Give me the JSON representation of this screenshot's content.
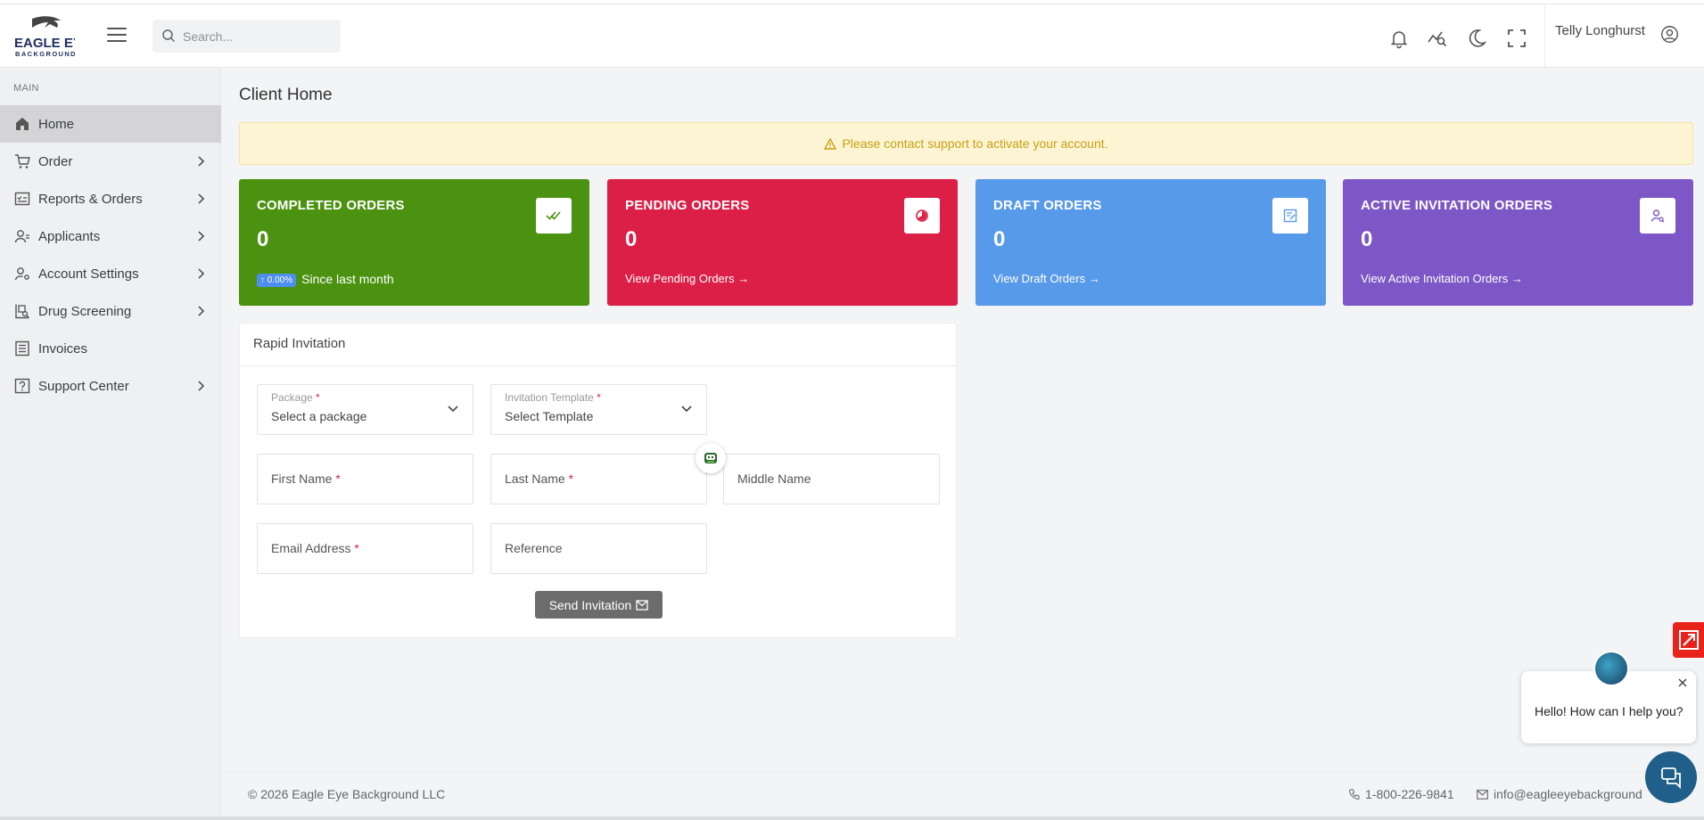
{
  "brand": {
    "logo_line1": "EAGLE EYE",
    "logo_line2": "BACKGROUNDS"
  },
  "search": {
    "placeholder": "Search..."
  },
  "header": {
    "user_name": "Telly Longhurst"
  },
  "sidebar": {
    "section_title": "MAIN",
    "items": [
      {
        "label": "Home",
        "icon": "home-icon",
        "active": true,
        "chevron": false
      },
      {
        "label": "Order",
        "icon": "cart-icon",
        "active": false,
        "chevron": true
      },
      {
        "label": "Reports & Orders",
        "icon": "report-icon",
        "active": false,
        "chevron": true
      },
      {
        "label": "Applicants",
        "icon": "applicants-icon",
        "active": false,
        "chevron": true
      },
      {
        "label": "Account Settings",
        "icon": "user-settings-icon",
        "active": false,
        "chevron": true
      },
      {
        "label": "Drug Screening",
        "icon": "drug-screening-icon",
        "active": false,
        "chevron": true
      },
      {
        "label": "Invoices",
        "icon": "invoice-icon",
        "active": false,
        "chevron": false
      },
      {
        "label": "Support Center",
        "icon": "support-icon",
        "active": false,
        "chevron": true
      }
    ]
  },
  "page": {
    "title": "Client Home",
    "alert": "Please contact support to activate your account."
  },
  "cards": [
    {
      "title": "COMPLETED ORDERS",
      "value": "0",
      "badge": "↑ 0.00%",
      "link": "Since last month",
      "color": "#4b9211",
      "icon": "double-check-icon"
    },
    {
      "title": "PENDING ORDERS",
      "value": "0",
      "link": "View Pending Orders",
      "color": "#dc1f47",
      "icon": "pending-icon"
    },
    {
      "title": "DRAFT ORDERS",
      "value": "0",
      "link": "View Draft Orders",
      "color": "#589aea",
      "icon": "draft-icon"
    },
    {
      "title": "ACTIVE INVITATION ORDERS",
      "value": "0",
      "link": "View Active Invitation Orders",
      "color": "#7d57c6",
      "icon": "invitation-user-icon"
    }
  ],
  "rapid": {
    "title": "Rapid Invitation",
    "package_label": "Package",
    "package_value": "Select a package",
    "template_label": "Invitation Template",
    "template_value": "Select Template",
    "first_name": "First Name",
    "last_name": "Last Name",
    "middle_name": "Middle Name",
    "email": "Email Address",
    "reference": "Reference",
    "required_mark": "*",
    "send_label": "Send Invitation"
  },
  "footer": {
    "copyright": "© 2026 Eagle Eye Background LLC",
    "phone": "1-800-226-9841",
    "email": "info@eagleeyebackground"
  },
  "chat": {
    "message": "Hello! How can I help you?"
  }
}
